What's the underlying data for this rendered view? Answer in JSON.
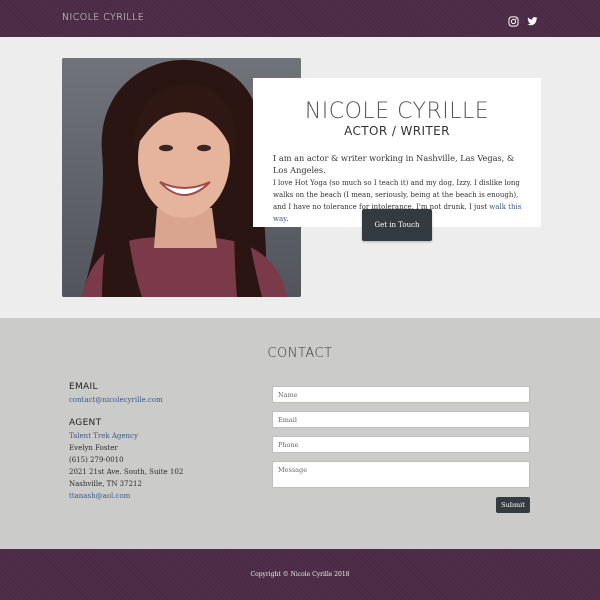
{
  "header": {
    "brand": "NICOLE CYRILLE",
    "social_icons": [
      "instagram-icon",
      "twitter-icon"
    ]
  },
  "hero": {
    "name": "NICOLE CYRILLE",
    "role": "ACTOR / WRITER",
    "bio_lead": "I am an actor & writer working in Nashville, Las Vegas, & Los Angeles.",
    "bio_body": "I love Hot Yoga (so much so I teach it) and my dog, Izzy. I dislike long walks on the beach (I mean, seriously, being at the beach is enough), and I have no tolerance for intolerance. I'm not drunk, I just",
    "bio_link": "walk this way",
    "bio_end": ".",
    "cta_label": "Get in Touch"
  },
  "contact": {
    "title": "CONTACT",
    "email_heading": "EMAIL",
    "email": "contact@nicolecyrille.com",
    "agent_heading": "AGENT",
    "agency": "Talent Trek Agency",
    "agent_name": "Evelyn Foster",
    "phone": "(615) 279-0010",
    "address1": "2021 21st Ave. South, Suite 102",
    "address2": "Nashville, TN 37212",
    "agent_email": "ttanash@aol.com",
    "form": {
      "name_placeholder": "Name",
      "email_placeholder": "Email",
      "phone_placeholder": "Phone",
      "message_placeholder": "Message",
      "submit_label": "Submit"
    }
  },
  "footer": {
    "copyright": "Copyright © Nicole Cyrille 2018"
  },
  "colors": {
    "nav_bg": "#4a2a44",
    "button_bg": "#333a40",
    "link": "#3b5a8a",
    "hero_bg": "#ededed",
    "contact_bg": "#cbcbc9"
  }
}
